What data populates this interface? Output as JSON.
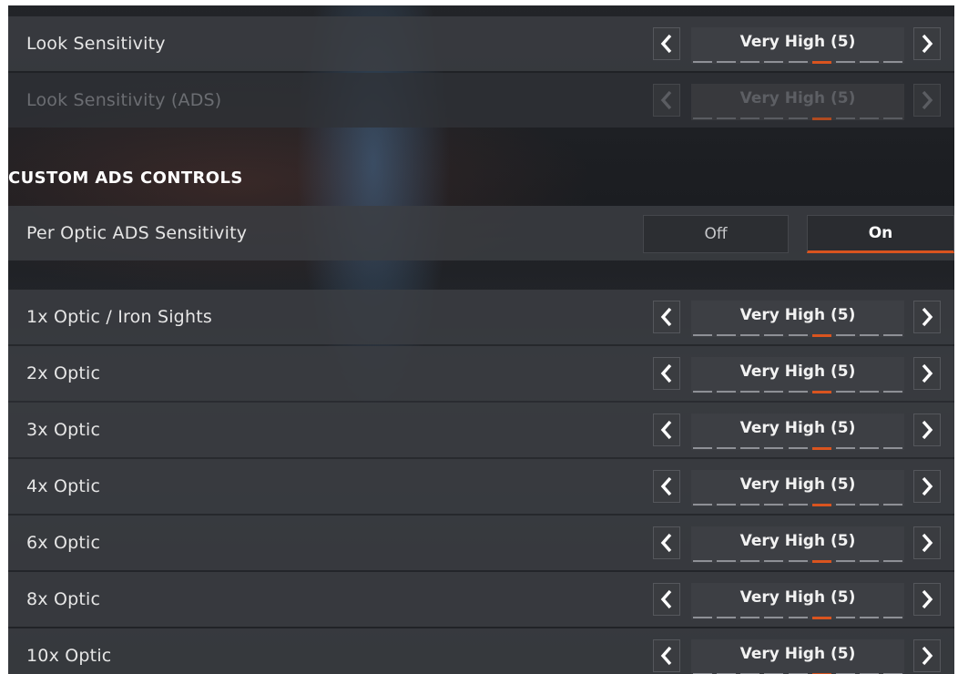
{
  "settings_top": [
    {
      "label": "Look Sensitivity",
      "value": "Very High  (5)",
      "level": 6,
      "max_level": 9,
      "enabled": true
    },
    {
      "label": "Look Sensitivity  (ADS)",
      "value": "Very High  (5)",
      "level": 6,
      "max_level": 9,
      "enabled": false
    }
  ],
  "section_header": "CUSTOM ADS CONTROLS",
  "per_optic": {
    "label": "Per Optic ADS Sensitivity",
    "off_label": "Off",
    "on_label": "On",
    "selected": "On"
  },
  "optics": [
    {
      "label": "1x Optic / Iron Sights",
      "value": "Very High  (5)",
      "level": 6,
      "max_level": 9
    },
    {
      "label": "2x Optic",
      "value": "Very High  (5)",
      "level": 6,
      "max_level": 9
    },
    {
      "label": "3x Optic",
      "value": "Very High  (5)",
      "level": 6,
      "max_level": 9
    },
    {
      "label": "4x Optic",
      "value": "Very High  (5)",
      "level": 6,
      "max_level": 9
    },
    {
      "label": "6x Optic",
      "value": "Very High  (5)",
      "level": 6,
      "max_level": 9
    },
    {
      "label": "8x Optic",
      "value": "Very High  (5)",
      "level": 6,
      "max_level": 9
    },
    {
      "label": "10x Optic",
      "value": "Very High  (5)",
      "level": 6,
      "max_level": 9
    }
  ],
  "colors": {
    "accent": "#d9541f",
    "row_bg": "#3c3e43",
    "text": "#e6e6e6"
  },
  "icons": {
    "decrease": "chevron-left-icon",
    "increase": "chevron-right-icon"
  }
}
